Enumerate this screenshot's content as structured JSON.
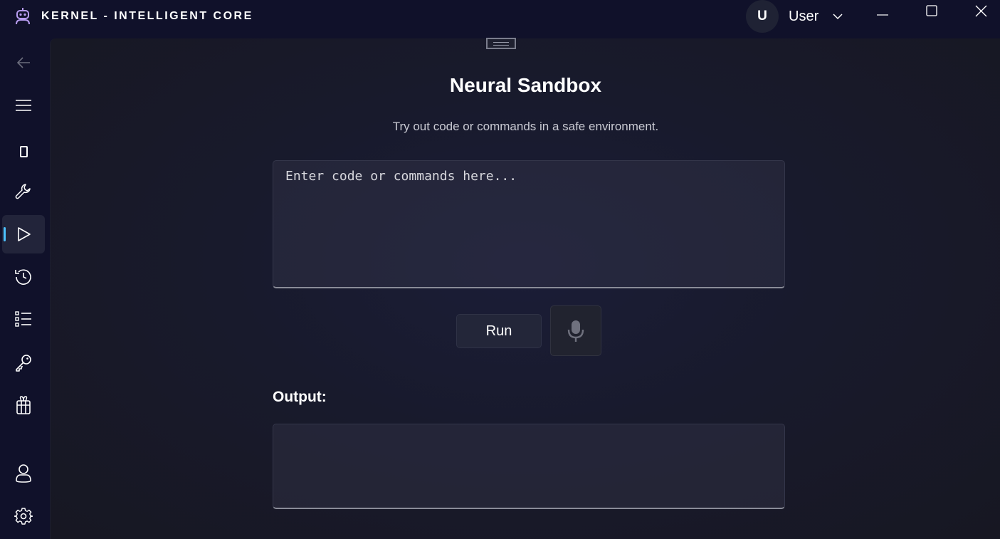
{
  "app": {
    "title": "KERNEL - INTELLIGENT CORE"
  },
  "user": {
    "initial": "U",
    "name": "User"
  },
  "sidebar": {
    "items": [
      {
        "name": "back",
        "icon": "back-arrow-icon"
      },
      {
        "name": "menu",
        "icon": "hamburger-menu-icon"
      },
      {
        "name": "device",
        "icon": "phone-icon"
      },
      {
        "name": "tools",
        "icon": "wrench-icon"
      },
      {
        "name": "sandbox",
        "icon": "play-icon",
        "active": true
      },
      {
        "name": "history",
        "icon": "history-icon"
      },
      {
        "name": "tasks",
        "icon": "task-list-icon"
      },
      {
        "name": "keys",
        "icon": "key-icon"
      },
      {
        "name": "gifts",
        "icon": "gift-icon"
      },
      {
        "name": "profile",
        "icon": "user-icon"
      },
      {
        "name": "settings",
        "icon": "gear-icon"
      }
    ]
  },
  "main": {
    "title": "Neural Sandbox",
    "subtitle": "Try out code or commands in a safe environment.",
    "input": {
      "placeholder": "Enter code or commands here...",
      "value": ""
    },
    "run_label": "Run",
    "mic_icon": "microphone-icon",
    "output_label": "Output:",
    "output_value": ""
  },
  "colors": {
    "accent": "#4cc2ff",
    "logo": "#b79cf0",
    "background": "#10112a"
  }
}
